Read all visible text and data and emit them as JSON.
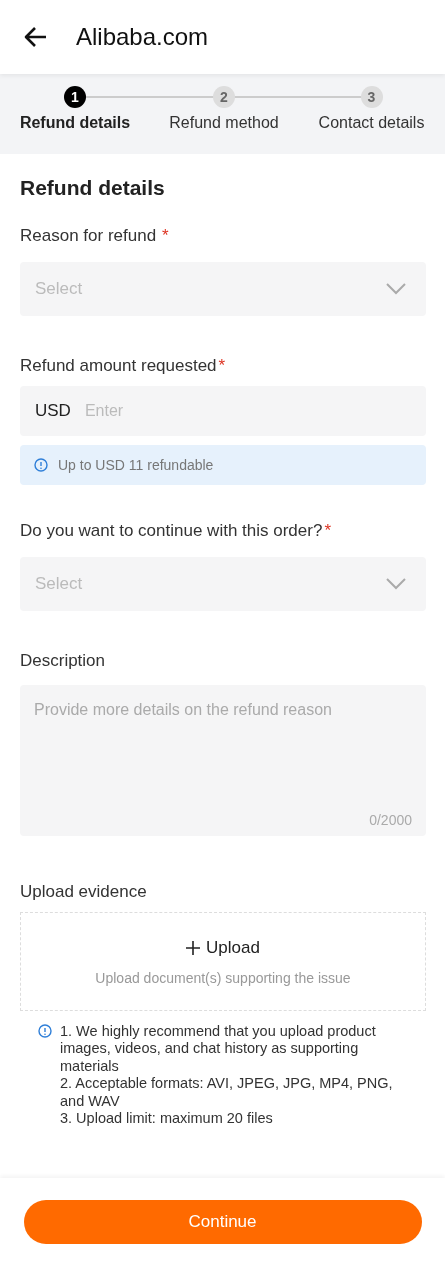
{
  "header": {
    "title": "Alibaba.com"
  },
  "steps": [
    {
      "number": "1",
      "label": "Refund details",
      "selected": true
    },
    {
      "number": "2",
      "label": "Refund method",
      "selected": false
    },
    {
      "number": "3",
      "label": "Contact details",
      "selected": false
    }
  ],
  "section_title": "Refund details",
  "fields": [
    {
      "kind": "select",
      "label": "Reason for refund",
      "required_mark": "*",
      "placeholder": "Select"
    },
    {
      "kind": "amount",
      "label": "Refund amount requested",
      "required_mark": "*",
      "currency": "USD",
      "placeholder": "Enter",
      "info": "Up to USD 11 refundable"
    },
    {
      "kind": "select",
      "label": "Do you want to continue with this order?",
      "required_mark": "*",
      "placeholder": "Select"
    },
    {
      "kind": "textarea",
      "label": "Description",
      "placeholder": "Provide more details on the refund reason",
      "counter": "0/2000"
    },
    {
      "kind": "upload",
      "label": "Upload evidence",
      "button": "Upload",
      "hint": "Upload document(s) supporting the issue",
      "notes": [
        "1. We highly recommend that you upload product images, videos, and chat history as supporting materials",
        "2. Acceptable formats: AVI, JPEG, JPG, MP4, PNG, and WAV",
        "3. Upload limit: maximum 20 files"
      ]
    }
  ],
  "continue_button": "Continue"
}
